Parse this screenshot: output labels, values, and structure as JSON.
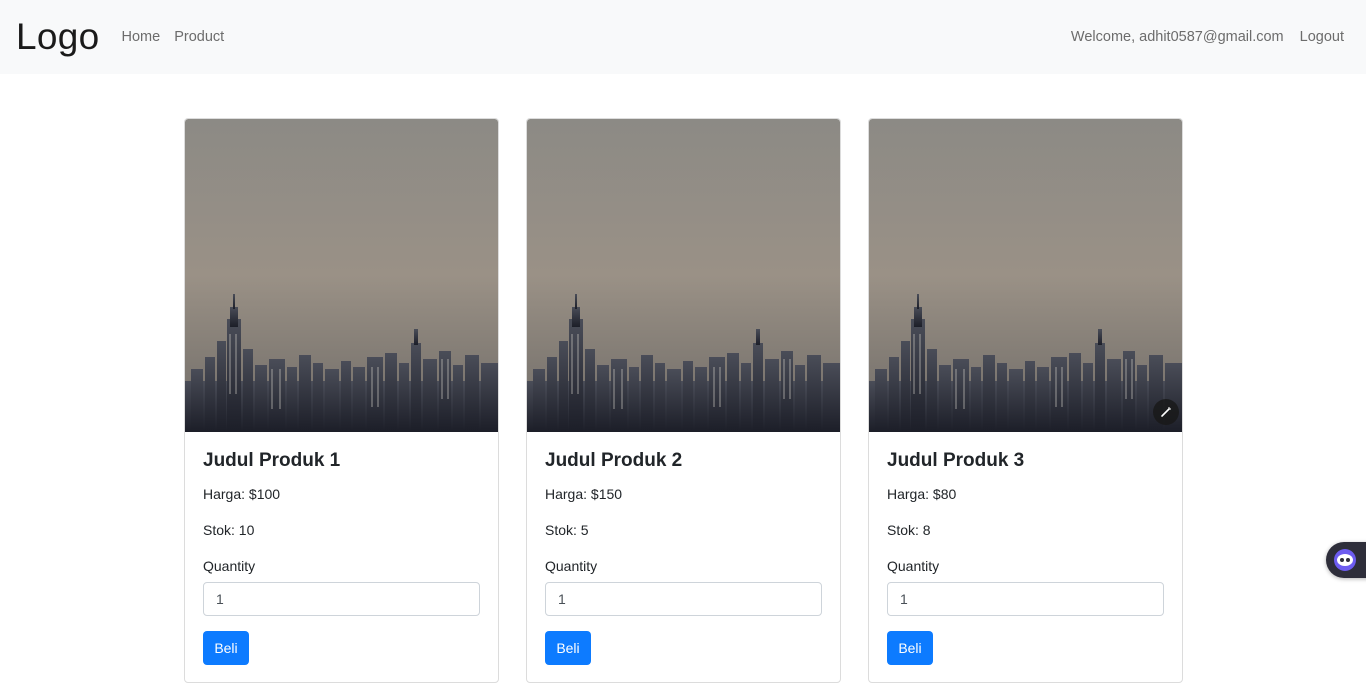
{
  "navbar": {
    "brand": "Logo",
    "links": [
      "Home",
      "Product"
    ],
    "welcome": "Welcome, adhit0587@gmail.com",
    "logout": "Logout"
  },
  "colors": {
    "navbar_bg": "#f8f9fa",
    "primary_button": "#0d7bff",
    "sky": "#9a9186"
  },
  "products": [
    {
      "title": "Judul Produk 1",
      "price": "Harga: $100",
      "stock": "Stok: 10",
      "quantity_label": "Quantity",
      "quantity_value": "1",
      "buy_label": "Beli"
    },
    {
      "title": "Judul Produk 2",
      "price": "Harga: $150",
      "stock": "Stok: 5",
      "quantity_label": "Quantity",
      "quantity_value": "1",
      "buy_label": "Beli"
    },
    {
      "title": "Judul Produk 3",
      "price": "Harga: $80",
      "stock": "Stok: 8",
      "quantity_label": "Quantity",
      "quantity_value": "1",
      "buy_label": "Beli"
    }
  ],
  "icons": {
    "image_overlay": "magic-wand-icon",
    "assistant": "assistant-bot-icon"
  }
}
